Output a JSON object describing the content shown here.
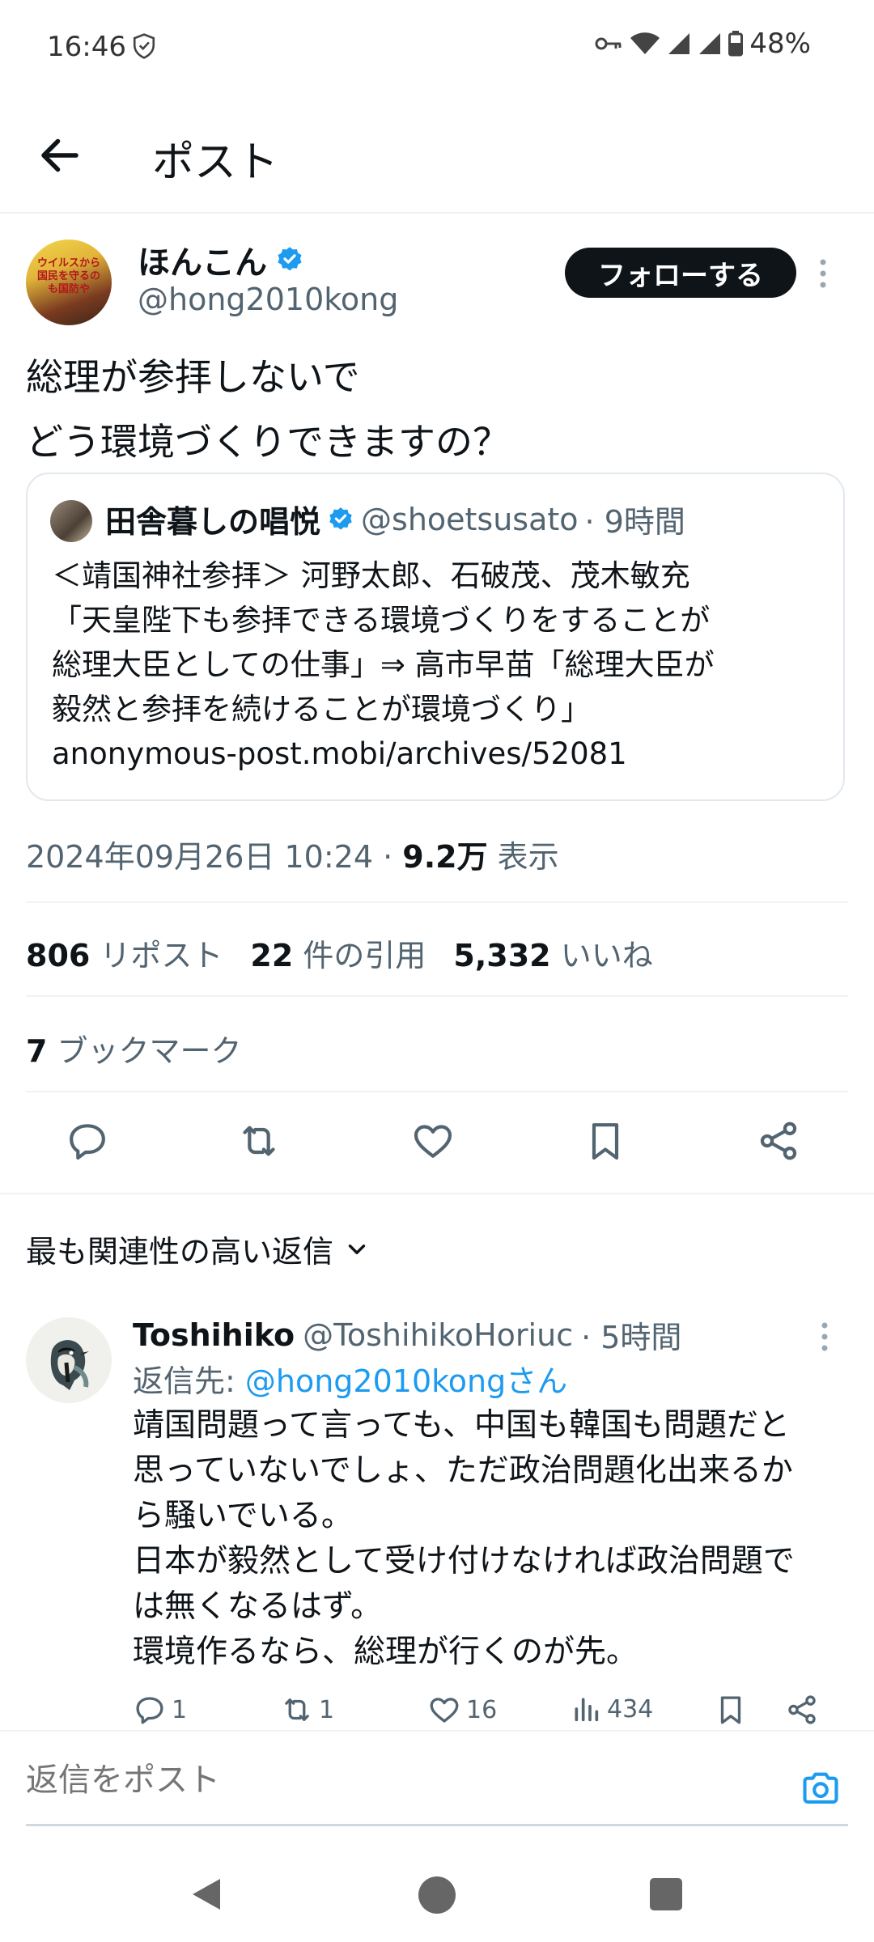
{
  "status": {
    "time": "16:46",
    "battery": "48%"
  },
  "header": {
    "title": "ポスト"
  },
  "author": {
    "name": "ほんこん",
    "handle": "@hong2010kong",
    "avatar_text": "ウイルスから国民を守るのも国防や"
  },
  "follow_label": "フォローする",
  "tweet": {
    "line1": "総理が参拝しないで",
    "line2": "どう環境づくりできますの？"
  },
  "quote": {
    "name": "田舎暮しの唱悦",
    "handle": "@shoetsusato",
    "time": "· 9時間",
    "lines": [
      "＜靖国神社参拝＞ 河野太郎、石破茂、茂木敏充",
      "「天皇陛下も参拝できる環境づくりをすることが",
      "総理大臣としての仕事」⇒ 高市早苗「総理大臣が",
      "毅然と参拝を続けることが環境づくり」",
      "anonymous-post.mobi/archives/52081"
    ]
  },
  "meta": {
    "datetime": "2024年09月26日 10:24 · ",
    "views": "9.2万",
    "views_label": " 表示"
  },
  "stats": {
    "reposts": "806",
    "reposts_label": " リポスト",
    "quotes": "22",
    "quotes_label": " 件の引用",
    "likes": "5,332",
    "likes_label": " いいね"
  },
  "bookmarks": {
    "count": "7",
    "label": " ブックマーク"
  },
  "replies_sort": "最も関連性の高い返信",
  "reply": {
    "name": "Toshihiko",
    "handle": "@ToshihikoHoriuc",
    "time": "· 5時間",
    "reply_to_prefix": "返信先: ",
    "reply_to_handle": "@hong2010kongさん",
    "lines": [
      "靖国問題って言っても、中国も韓国も問題だと",
      "思っていないでしょ、ただ政治問題化出来るか",
      "ら騒いでいる。",
      "日本が毅然として受け付けなければ政治問題で",
      "は無くなるはず。",
      "環境作るなら、総理が行くのが先。"
    ],
    "replies": "1",
    "reposts": "1",
    "likes": "16",
    "views": "434"
  },
  "compose": {
    "placeholder": "返信をポスト"
  },
  "icons": {
    "back": "arrow-left-icon",
    "verified": "verified-badge-icon",
    "more": "more-vertical-icon",
    "reply": "reply-icon",
    "repost": "repost-icon",
    "like": "heart-icon",
    "bookmark": "bookmark-icon",
    "share": "share-icon",
    "camera": "camera-icon",
    "views": "bar-chart-icon"
  },
  "colors": {
    "accent": "#1d9bf0",
    "text": "#0f1419",
    "muted": "#536471",
    "follow_bg": "#0f1419"
  }
}
